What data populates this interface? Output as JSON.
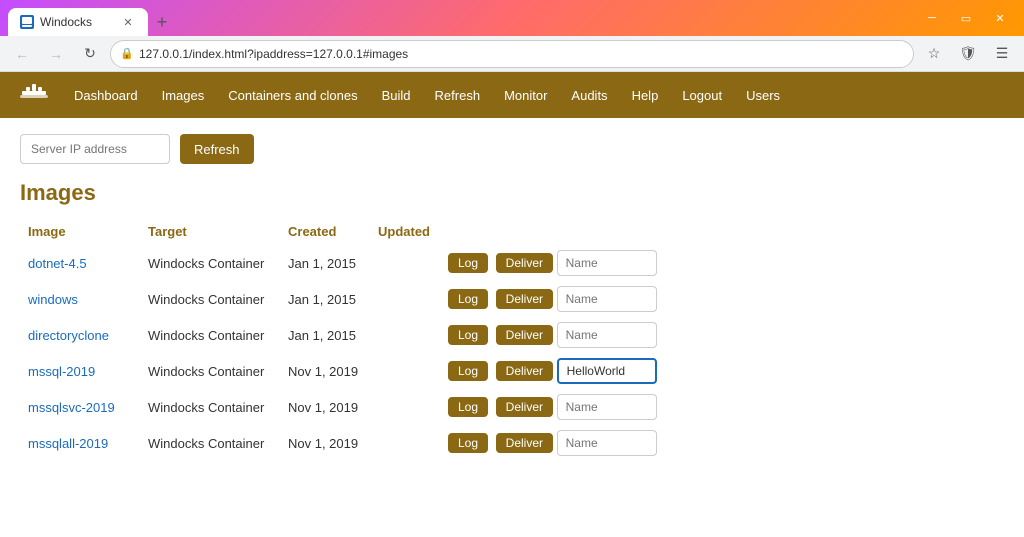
{
  "browser": {
    "tab_title": "Windocks",
    "url": "127.0.0.1/index.html?ipaddress=127.0.0.1#images",
    "new_tab_label": "+"
  },
  "navbar": {
    "links": [
      {
        "label": "Dashboard",
        "id": "dashboard"
      },
      {
        "label": "Images",
        "id": "images"
      },
      {
        "label": "Containers and clones",
        "id": "containers"
      },
      {
        "label": "Build",
        "id": "build"
      },
      {
        "label": "Refresh",
        "id": "refresh"
      },
      {
        "label": "Monitor",
        "id": "monitor"
      },
      {
        "label": "Audits",
        "id": "audits"
      },
      {
        "label": "Help",
        "id": "help"
      },
      {
        "label": "Logout",
        "id": "logout"
      },
      {
        "label": "Users",
        "id": "users"
      }
    ]
  },
  "topbar": {
    "server_placeholder": "Server IP address",
    "refresh_label": "Refresh"
  },
  "page": {
    "title": "Images"
  },
  "table": {
    "headers": [
      "Image",
      "Target",
      "Created",
      "Updated"
    ],
    "rows": [
      {
        "image": "dotnet-4.5",
        "target": "Windocks Container",
        "created": "Jan 1, 2015",
        "updated": "",
        "name_value": ""
      },
      {
        "image": "windows",
        "target": "Windocks Container",
        "created": "Jan 1, 2015",
        "updated": "",
        "name_value": ""
      },
      {
        "image": "directoryclone",
        "target": "Windocks Container",
        "created": "Jan 1, 2015",
        "updated": "",
        "name_value": ""
      },
      {
        "image": "mssql-2019",
        "target": "Windocks Container",
        "created": "Nov 1, 2019",
        "updated": "",
        "name_value": "HelloWorld"
      },
      {
        "image": "mssqlsvc-2019",
        "target": "Windocks Container",
        "created": "Nov 1, 2019",
        "updated": "",
        "name_value": ""
      },
      {
        "image": "mssqlall-2019",
        "target": "Windocks Container",
        "created": "Nov 1, 2019",
        "updated": "",
        "name_value": ""
      }
    ],
    "log_label": "Log",
    "deliver_label": "Deliver",
    "name_placeholder": "Name"
  }
}
